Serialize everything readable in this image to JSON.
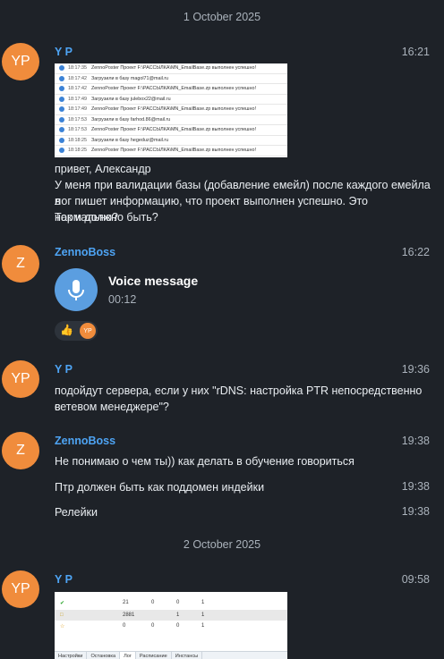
{
  "dates": {
    "first": "1 October 2025",
    "second": "2 October 2025"
  },
  "messages": {
    "m1": {
      "avatar": "YP",
      "name": "Y P",
      "time": "16:21",
      "log_rows": [
        {
          "time": "18:17:35",
          "text": "ZennoPoster Проект F:\\РАССЫЛКА\\MN_EmailBase.zp выполнен успешно!"
        },
        {
          "time": "18:17:42",
          "text": "Загрузили в базу magol71@mail.ru"
        },
        {
          "time": "18:17:42",
          "text": "ZennoPoster Проект F:\\РАССЫЛКА\\MN_EmailBase.zp выполнен успешно!"
        },
        {
          "time": "18:17:49",
          "text": "Загрузили в базу julebox22@mail.ru"
        },
        {
          "time": "18:17:49",
          "text": "ZennoPoster Проект F:\\РАССЫЛКА\\MN_EmailBase.zp выполнен успешно!"
        },
        {
          "time": "18:17:53",
          "text": "Загрузили в базу farhod.86@mail.ru"
        },
        {
          "time": "18:17:53",
          "text": "ZennoPoster Проект F:\\РАССЫЛКА\\MN_EmailBase.zp выполнен успешно!"
        },
        {
          "time": "18:18:25",
          "text": "Загрузили в базу hegeduz@mail.ru"
        },
        {
          "time": "18:18:25",
          "text": "ZennoPoster Проект F:\\РАССЫЛКА\\MN_EmailBase.zp выполнен успешно!"
        }
      ],
      "line1": "привет, Александр",
      "line2": "У меня при валидации базы (добавление емейл) после каждого емейла в",
      "line3": "лог пишет информацию, что проект выполнен успешно. Это нормально?",
      "line4": "Так и должно быть?"
    },
    "m2": {
      "avatar": "Z",
      "name": "ZennoBoss",
      "time": "16:22",
      "voice_title": "Voice message",
      "voice_duration": "00:12",
      "reaction_emoji": "👍",
      "reaction_user": "YP",
      "mic_icon": "microphone-icon"
    },
    "m3": {
      "avatar": "YP",
      "name": "Y P",
      "time": "19:36",
      "line1": "подойдут сервера, если у них \"rDNS: настройка PTR непосредственно в",
      "line2": "сетевом менеджере\"?"
    },
    "m4": {
      "avatar": "Z",
      "name": "ZennoBoss",
      "time": "19:38",
      "text": "Не понимаю о чем ты)) как делать в обучение говориться",
      "text2": "Птр должен быть как поддомен индейки",
      "time2": "19:38",
      "text3": "Релейки",
      "time3": "19:38"
    },
    "m5": {
      "avatar": "YP",
      "name": "Y P",
      "time": "09:58",
      "table_rows": [
        {
          "c1": "21",
          "c2": "0",
          "c3": "0",
          "c4": "1"
        },
        {
          "c1": "2881",
          "c2": "",
          "c3": "1",
          "c4": "1"
        },
        {
          "c1": "0",
          "c2": "0",
          "c3": "0",
          "c4": "1"
        }
      ],
      "tabs": [
        "Настройки",
        "Остановка",
        "Лог",
        "Расписание",
        "Инстансы"
      ]
    }
  },
  "colors": {
    "background": "#1e2228",
    "name": "#4ea4f4",
    "avatar": "#f08c3c",
    "voice_button": "#5b9ee0"
  }
}
